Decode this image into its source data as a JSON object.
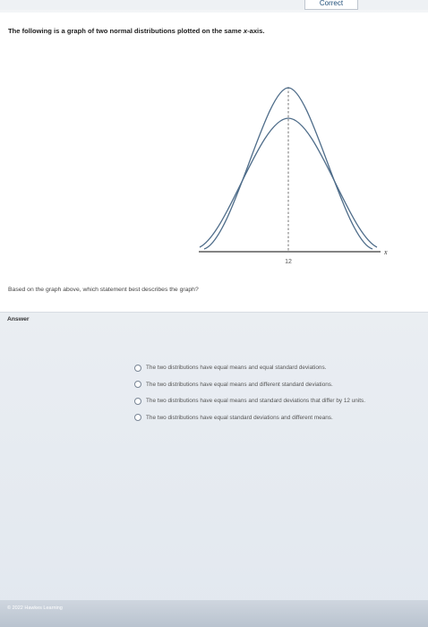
{
  "header": {
    "status_label": "Correct"
  },
  "question": {
    "text_before": "The following is a graph of two normal distributions plotted on the same ",
    "text_var": "x",
    "text_after": "-axis.",
    "prompt": "Based on the graph above, which statement best describes the graph?"
  },
  "graph": {
    "mean_label": "12",
    "x_axis_label": "x"
  },
  "answer": {
    "label": "Answer",
    "options": [
      "The two distributions have equal means and equal standard deviations.",
      "The two distributions have equal means and different standard deviations.",
      "The two distributions have equal means and standard deviations that differ by 12 units.",
      "The two distributions have equal standard deviations and different means."
    ]
  },
  "footer": {
    "copyright": "© 2022 Hawkes Learning"
  }
}
